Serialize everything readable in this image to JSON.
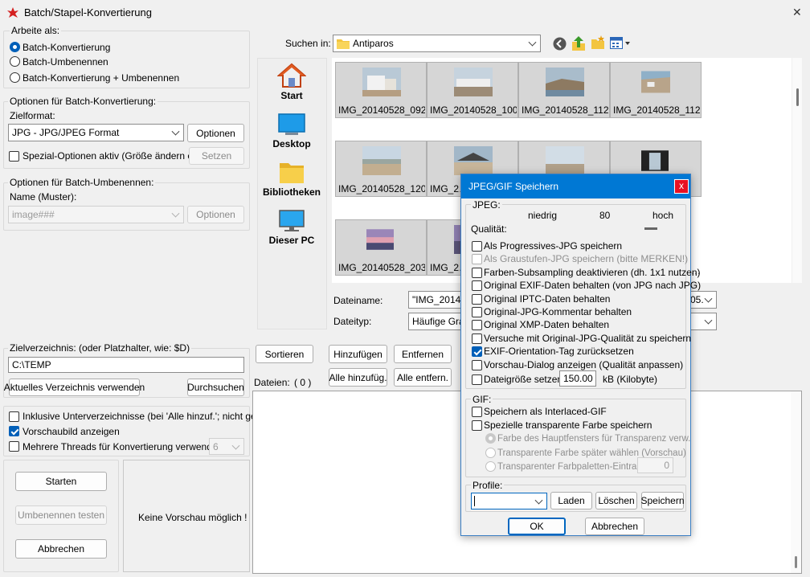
{
  "window": {
    "title": "Batch/Stapel-Konvertierung",
    "close_glyph": "✕"
  },
  "work_mode": {
    "label": "Arbeite als:",
    "options": [
      "Batch-Konvertierung",
      "Batch-Umbenennen",
      "Batch-Konvertierung + Umbenennen"
    ],
    "selected": "Batch-Konvertierung"
  },
  "convert_options": {
    "label": "Optionen für Batch-Konvertierung:",
    "format_label": "Zielformat:",
    "format_value": "JPG - JPG/JPEG Format",
    "options_button": "Optionen",
    "special_checkbox": "Spezial-Optionen aktiv (Größe ändern etc.)",
    "special_checked": false,
    "set_button": "Setzen"
  },
  "rename_options": {
    "label": "Optionen für Batch-Umbenennen:",
    "pattern_label": "Name (Muster):",
    "pattern_value": "image###",
    "options_button": "Optionen"
  },
  "target_dir": {
    "label": "Zielverzeichnis: (oder Platzhalter, wie: $D)",
    "value": "C:\\TEMP",
    "use_current_button": "Aktuelles Verzeichnis verwenden",
    "browse_button": "Durchsuchen"
  },
  "flags": {
    "subdirs": {
      "label": "Inklusive Unterverzeichnisse (bei 'Alle hinzuf.'; nicht gesp.)",
      "checked": false
    },
    "preview": {
      "label": "Vorschaubild anzeigen",
      "checked": true
    },
    "threads": {
      "label": "Mehrere Threads für Konvertierung verwenden:",
      "checked": false,
      "value": "6"
    }
  },
  "actions": {
    "start": "Starten",
    "test_rename": "Umbenennen testen",
    "cancel": "Abbrechen"
  },
  "preview_text": "Keine Vorschau möglich !",
  "browser": {
    "search_label": "Suchen in:",
    "folder": "Antiparos",
    "nav": [
      "Start",
      "Desktop",
      "Bibliotheken",
      "Dieser PC"
    ],
    "files": [
      "IMG_20140528_092…",
      "IMG_20140528_100…",
      "IMG_20140528_112…",
      "IMG_20140528_112…",
      "IMG_20140528_120…",
      "IMG_2…",
      "",
      "",
      "IMG_20140528_203…",
      "IMG_2…"
    ],
    "filename_label": "Dateiname:",
    "filename_value": "\"IMG_2014…",
    "filename_tail": "05.",
    "filetype_label": "Dateityp:",
    "filetype_value": "Häufige Grap…",
    "sort_button": "Sortieren",
    "add_button": "Hinzufügen",
    "remove_button": "Entfernen",
    "add_all_button": "Alle hinzufüg.",
    "remove_all_button": "Alle entfern.",
    "files_label": "Dateien:",
    "files_count": "( 0 )"
  },
  "dialog": {
    "title": "JPEG/GIF Speichern",
    "close_glyph": "x",
    "jpeg_label": "JPEG:",
    "low_label": "niedrig",
    "quality_value": "80",
    "high_label": "hoch",
    "quality_label": "Qualität:",
    "quality_level": 0.8,
    "jpeg_options": [
      {
        "label": "Als Progressives-JPG speichern",
        "checked": false,
        "disabled": false
      },
      {
        "label": "Als Graustufen-JPG speichern (bitte MERKEN!)",
        "checked": false,
        "disabled": true
      },
      {
        "label": "Farben-Subsampling deaktivieren (dh. 1x1 nutzen)",
        "checked": false,
        "disabled": false
      },
      {
        "label": "Original EXIF-Daten behalten (von JPG nach JPG)",
        "checked": false,
        "disabled": false
      },
      {
        "label": "Original IPTC-Daten behalten",
        "checked": false,
        "disabled": false
      },
      {
        "label": "Original-JPG-Kommentar behalten",
        "checked": false,
        "disabled": false
      },
      {
        "label": "Original XMP-Daten behalten",
        "checked": false,
        "disabled": false
      },
      {
        "label": "Versuche mit Original-JPG-Qualität zu speichern",
        "checked": false,
        "disabled": false
      },
      {
        "label": "EXIF-Orientation-Tag zurücksetzen",
        "checked": true,
        "disabled": false
      },
      {
        "label": "Vorschau-Dialog anzeigen (Qualität anpassen)",
        "checked": false,
        "disabled": false
      }
    ],
    "filesize_label": "Dateigröße setzen:",
    "filesize_checked": false,
    "filesize_value": "150.00",
    "filesize_unit": "kB (Kilobyte)",
    "gif_label": "GIF:",
    "gif_options": [
      {
        "label": "Speichern als Interlaced-GIF",
        "checked": false
      },
      {
        "label": "Spezielle transparente Farbe speichern",
        "checked": false
      }
    ],
    "transparency_options": [
      "Farbe des Hauptfensters für Transparenz verw.",
      "Transparente Farbe später wählen (Vorschau)",
      "Transparenter Farbpaletten-Eintrag:"
    ],
    "palette_value": "0",
    "profile_label": "Profile:",
    "profile_value": "",
    "load_button": "Laden",
    "delete_button": "Löschen",
    "save_button": "Speichern",
    "ok_button": "OK",
    "cancel_button": "Abbrechen"
  },
  "colors": {
    "accent": "#005fb8",
    "dialog_title": "#0078d4",
    "close_red": "#e81123"
  }
}
